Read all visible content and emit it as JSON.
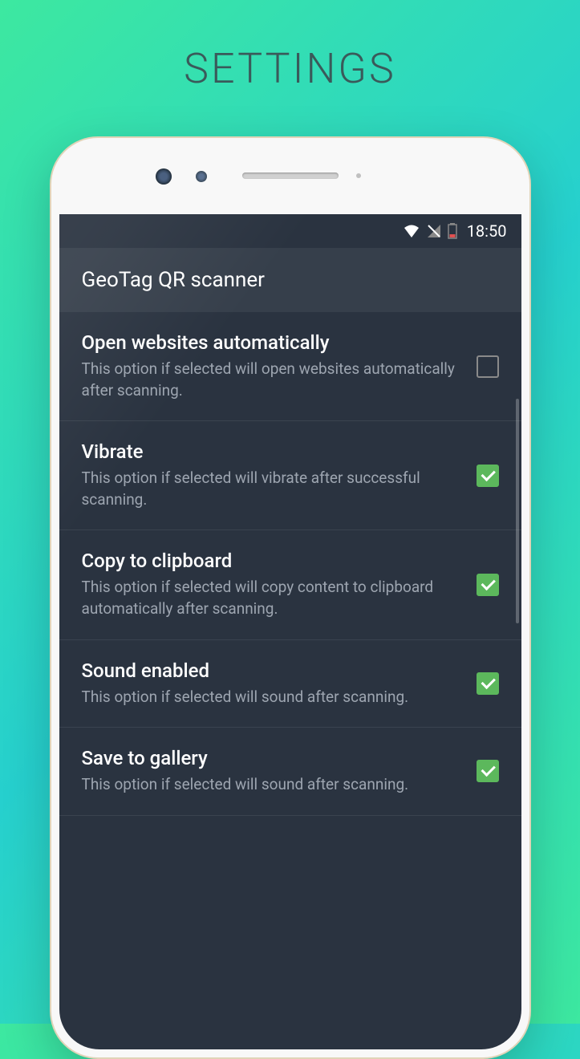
{
  "pageTitle": "SETTINGS",
  "statusBar": {
    "time": "18:50"
  },
  "appBar": {
    "title": "GeoTag QR scanner"
  },
  "settings": [
    {
      "title": "Open websites automatically",
      "desc": "This option if selected will open websites automatically after scanning.",
      "checked": false
    },
    {
      "title": "Vibrate",
      "desc": "This option if selected will vibrate after successful scanning.",
      "checked": true
    },
    {
      "title": "Copy to clipboard",
      "desc": "This option if selected will copy content to clipboard automatically after scanning.",
      "checked": true
    },
    {
      "title": "Sound enabled",
      "desc": "This option if selected will sound after scanning.",
      "checked": true
    },
    {
      "title": "Save to gallery",
      "desc": "This option if selected will sound after scanning.",
      "checked": true
    }
  ]
}
